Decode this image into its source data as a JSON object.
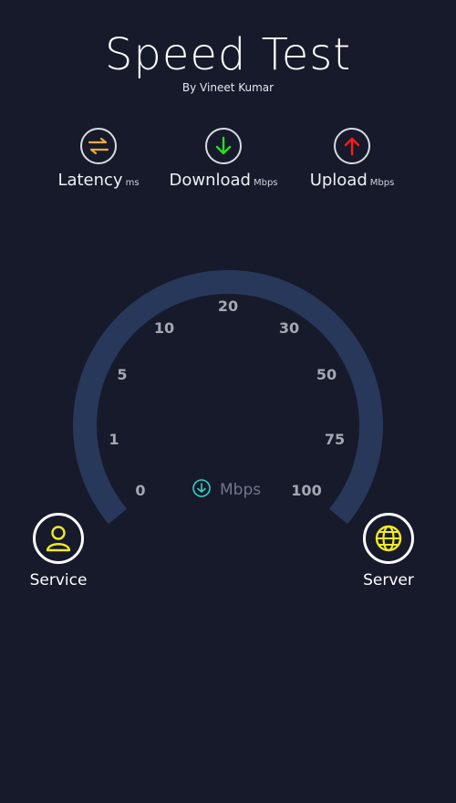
{
  "header": {
    "title": "Speed Test",
    "subtitle": "By Vineet Kumar"
  },
  "metrics": [
    {
      "label": "Latency",
      "unit": "ms",
      "icon": "swap-arrows-icon",
      "color": "#f0a93a"
    },
    {
      "label": "Download",
      "unit": "Mbps",
      "icon": "arrow-down-icon",
      "color": "#22e022"
    },
    {
      "label": "Upload",
      "unit": "Mbps",
      "icon": "arrow-up-icon",
      "color": "#ff1a1a"
    }
  ],
  "gauge": {
    "unit_label": "Mbps",
    "ticks": [
      "0",
      "1",
      "5",
      "10",
      "20",
      "30",
      "50",
      "75",
      "100"
    ],
    "track_color": "#28385a",
    "accent": "#2fd1c5"
  },
  "actions": {
    "service_label": "Service",
    "server_label": "Server",
    "icon_color": "#f2ea1c"
  }
}
